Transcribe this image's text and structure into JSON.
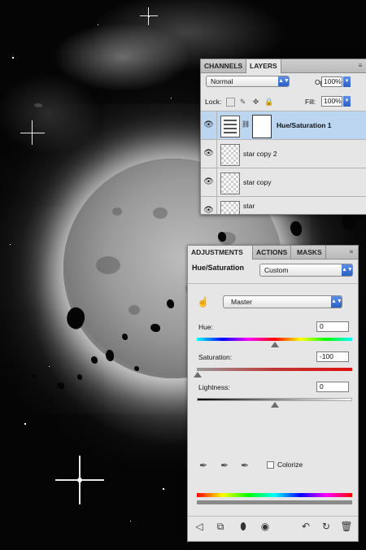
{
  "layers_panel": {
    "tabs": [
      "CHANNELS",
      "LAYERS"
    ],
    "active_tab": "LAYERS",
    "blend_mode": "Normal",
    "opacity_label": "Opacity:",
    "opacity_value": "100%",
    "lock_label": "Lock:",
    "fill_label": "Fill:",
    "fill_value": "100%",
    "layers": [
      {
        "name": "Hue/Saturation 1",
        "selected": true,
        "type": "adjustment"
      },
      {
        "name": "star copy 2",
        "selected": false,
        "type": "pixel"
      },
      {
        "name": "star copy",
        "selected": false,
        "type": "pixel"
      },
      {
        "name": "star",
        "selected": false,
        "type": "pixel"
      }
    ]
  },
  "adjustments_panel": {
    "tabs": [
      "ADJUSTMENTS",
      "ACTIONS",
      "MASKS"
    ],
    "active_tab": "ADJUSTMENTS",
    "title": "Hue/Saturation",
    "preset": "Custom",
    "channel": "Master",
    "hue_label": "Hue:",
    "hue_value": "0",
    "saturation_label": "Saturation:",
    "saturation_value": "-100",
    "lightness_label": "Lightness:",
    "lightness_value": "0",
    "colorize_label": "Colorize",
    "colorize_checked": false,
    "slider_levels": {
      "hue": 0.5,
      "saturation": 0.0,
      "lightness": 0.5
    },
    "footer_icons": [
      "back-arrow-icon",
      "clip-icon",
      "mask-icon",
      "visibility-icon",
      "previous-state-icon",
      "reset-icon",
      "trash-icon"
    ]
  },
  "colors": {
    "selected_layer": "#bcd5f0",
    "accent_blue": "#2a5fc5",
    "panel_bg": "#e6e6e6"
  }
}
